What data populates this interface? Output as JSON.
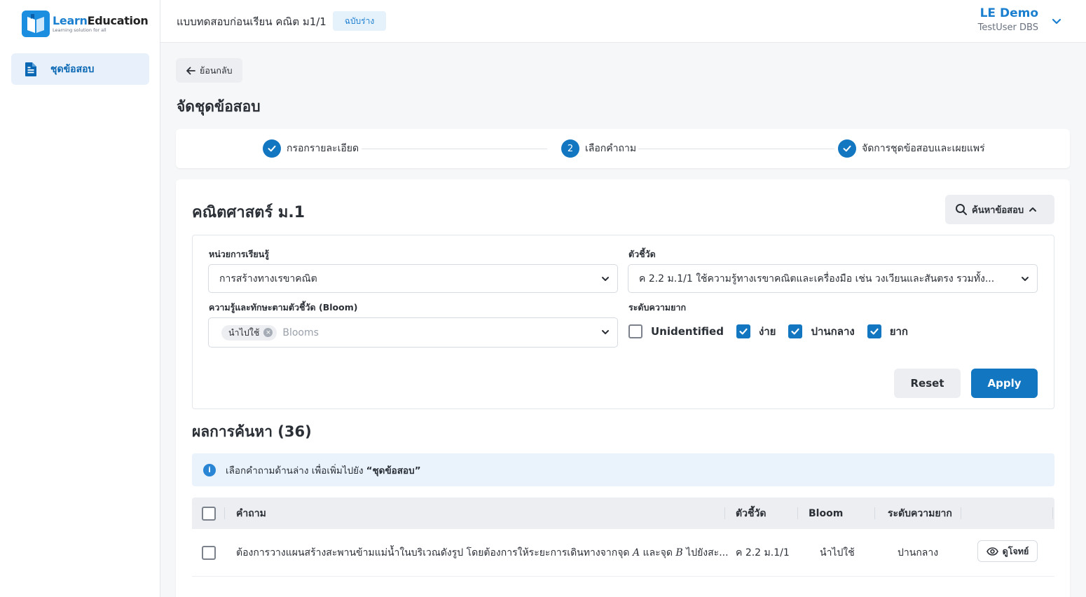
{
  "brand": {
    "learn": "Learn",
    "education": "Education",
    "tagline": "Learning solution for all"
  },
  "sidebar": {
    "items": [
      {
        "label": "ชุดข้อสอบ",
        "icon": "document-icon"
      }
    ]
  },
  "header": {
    "exam_title": "แบบทดสอบก่อนเรียน คณิต ม1/1",
    "status_badge": "ฉบับร่าง",
    "user_name": "LE Demo",
    "user_sub": "TestUser DBS"
  },
  "back_label": "ย้อนกลับ",
  "page_title": "จัดชุดข้อสอบ",
  "stepper": {
    "steps": [
      {
        "label": "กรอกรายละเอียด",
        "state": "done"
      },
      {
        "label": "เลือกคำถาม",
        "state": "current",
        "number": "2"
      },
      {
        "label": "จัดการชุดข้อสอบและเผยแพร่",
        "state": "done"
      }
    ]
  },
  "subject": "คณิตศาสตร์ ม.1",
  "search_toggle_label": "ค้นหาข้อสอบ",
  "filters": {
    "unit_label": "หน่วยการเรียนรู้",
    "unit_value": "การสร้างทางเรขาคณิต",
    "indicator_label": "ตัวชี้วัด",
    "indicator_value": "ค 2.2 ม.1/1 ใช้ความรู้ทางเรขาคณิตและเครื่องมือ เช่น วงเวียนและสันตรง รวมทั้ง...",
    "bloom_label": "ความรู้และทักษะตามตัวชี้วัด (Bloom)",
    "bloom_chip": "นำไปใช้",
    "bloom_placeholder": "Blooms",
    "difficulty_label": "ระดับความยาก",
    "difficulty_options": [
      {
        "label": "Unidentified",
        "checked": false
      },
      {
        "label": "ง่าย",
        "checked": true
      },
      {
        "label": "ปานกลาง",
        "checked": true
      },
      {
        "label": "ยาก",
        "checked": true
      }
    ],
    "reset_label": "Reset",
    "apply_label": "Apply"
  },
  "results": {
    "title": "ผลการค้นหา (36)",
    "info_text": "เลือกคำถามด้านล่าง เพื่อเพิ่มไปยัง",
    "info_target": "“ชุดข้อสอบ”",
    "columns": [
      "คำถาม",
      "ตัวชี้วัด",
      "Bloom",
      "ระดับความยาก"
    ],
    "rows": [
      {
        "question_pre": "ต้องการวางแผนสร้างสะพานข้ามแม่น้ำในบริเวณดังรูป โดยต้องการให้ระยะการเดินทางจากจุด",
        "var_a": "A",
        "question_mid": "และจุด",
        "var_b": "B",
        "question_post": "ไปยังสะ...",
        "indicator": "ค 2.2 ม.1/1",
        "bloom": "นำไปใช้",
        "difficulty": "ปานกลาง",
        "view_label": "ดูโจทย์"
      }
    ]
  }
}
